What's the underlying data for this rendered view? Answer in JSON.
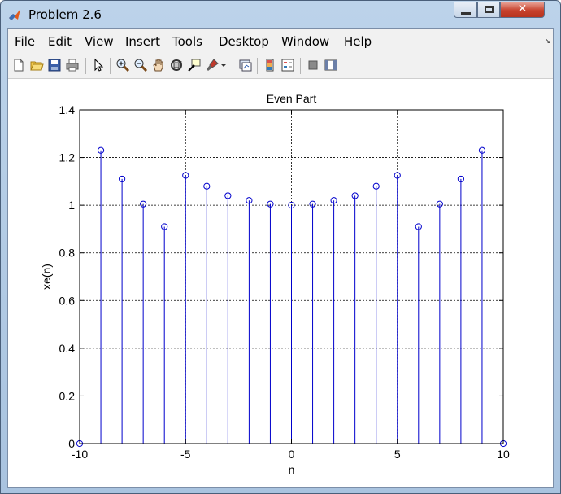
{
  "window": {
    "title": "Problem 2.6",
    "minimize_glyph": "",
    "maximize_glyph": "",
    "close_glyph": "✕"
  },
  "menu": {
    "items": [
      {
        "label": "File"
      },
      {
        "label": "Edit"
      },
      {
        "label": "View"
      },
      {
        "label": "Insert"
      },
      {
        "label": "Tools"
      },
      {
        "label": "Desktop"
      },
      {
        "label": "Window"
      },
      {
        "label": "Help"
      }
    ],
    "overflow_arrow": "↘"
  },
  "toolbar": {
    "icons": [
      "new-figure-icon",
      "open-file-icon",
      "save-icon",
      "print-icon",
      "edit-plot-icon",
      "zoom-in-icon",
      "zoom-out-icon",
      "pan-icon",
      "rotate-3d-icon",
      "data-cursor-icon",
      "brush-icon",
      "brush-dropdown-icon",
      "link-plot-icon",
      "colorbar-icon",
      "legend-icon",
      "hide-plot-tools-icon",
      "show-plot-tools-icon"
    ]
  },
  "colors": {
    "stem": "#0000cc",
    "axis": "#000000",
    "grid": "#000000"
  },
  "chart_data": {
    "type": "stem",
    "title": "Even Part",
    "xlabel": "n",
    "ylabel": "xe(n)",
    "xlim": [
      -10,
      10
    ],
    "ylim": [
      0,
      1.4
    ],
    "xticks": [
      -10,
      -5,
      0,
      5,
      10
    ],
    "xtick_labels": [
      "-10",
      "-5",
      "0",
      "5",
      "10"
    ],
    "yticks": [
      0,
      0.2,
      0.4,
      0.6,
      0.8,
      1,
      1.2,
      1.4
    ],
    "ytick_labels": [
      "0",
      "0.2",
      "0.4",
      "0.6",
      "0.8",
      "1",
      "1.2",
      "1.4"
    ],
    "grid": true,
    "grid_style": "dotted",
    "x": [
      -10,
      -9,
      -8,
      -7,
      -6,
      -5,
      -4,
      -3,
      -2,
      -1,
      0,
      1,
      2,
      3,
      4,
      5,
      6,
      7,
      8,
      9,
      10
    ],
    "y": [
      0,
      1.23,
      1.11,
      1.005,
      0.91,
      1.125,
      1.08,
      1.04,
      1.02,
      1.005,
      1.0,
      1.005,
      1.02,
      1.04,
      1.08,
      1.125,
      0.91,
      1.005,
      1.11,
      1.23,
      0
    ]
  }
}
